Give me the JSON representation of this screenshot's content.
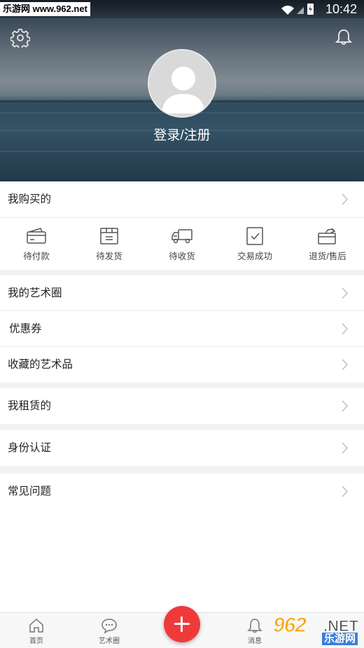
{
  "status_bar": {
    "watermark": "乐游网 www.962.net",
    "time": "10:42"
  },
  "header": {
    "login_label": "登录/注册"
  },
  "purchases": {
    "title": "我购买的",
    "orders": [
      {
        "label": "待付款",
        "icon": "card-icon"
      },
      {
        "label": "待发货",
        "icon": "box-icon"
      },
      {
        "label": "待收货",
        "icon": "truck-icon"
      },
      {
        "label": "交易成功",
        "icon": "check-square-icon"
      },
      {
        "label": "退货/售后",
        "icon": "return-icon"
      }
    ]
  },
  "menu": {
    "art_circle": "我的艺术圈",
    "coupons": "优惠券",
    "favorites": "收藏的艺术品",
    "rentals": "我租赁的",
    "verification": "身份认证",
    "faq": "常见问题"
  },
  "tabbar": {
    "tabs": [
      {
        "label": "首页",
        "icon": "home-icon"
      },
      {
        "label": "艺术圈",
        "icon": "chat-bubble-icon"
      },
      {
        "label": "消息",
        "icon": "bell-icon"
      }
    ]
  },
  "watermark_br": {
    "number": "962",
    "net": ".NET",
    "cn": "乐游网"
  },
  "colors": {
    "accent": "#f03a3a",
    "watermark_orange": "#f6a91a",
    "watermark_blue": "#3b7fd8"
  }
}
